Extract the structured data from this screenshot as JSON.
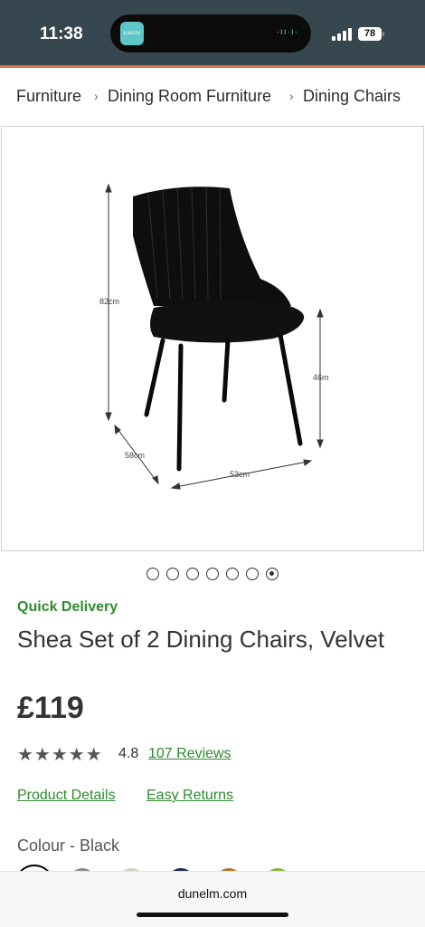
{
  "status_bar": {
    "time": "11:38",
    "battery": "78",
    "island_app_label": "KARON FAT"
  },
  "breadcrumb": {
    "items": [
      "Furniture",
      "Dining Room Furniture",
      "Dining Chairs"
    ],
    "separator": "›"
  },
  "gallery": {
    "dimensions": {
      "height": "82cm",
      "seat_height": "46m",
      "depth": "58cm",
      "width": "53cm"
    },
    "image_count": 7,
    "active_index": 6
  },
  "product": {
    "delivery_badge": "Quick Delivery",
    "title": "Shea Set of 2 Dining Chairs, Velvet",
    "price": "£119",
    "stars_text": "★★★★★",
    "rating": "4.8",
    "reviews_link": "107 Reviews",
    "details_link": "Product Details",
    "returns_link": "Easy Returns",
    "colour_label": "Colour - Black"
  },
  "swatches": [
    {
      "name": "Black",
      "color": "#111111"
    },
    {
      "name": "Grey",
      "color": "#8c8c8c"
    },
    {
      "name": "Natural",
      "color": "#d9cfc2"
    },
    {
      "name": "Navy",
      "color": "#1f2a5a"
    },
    {
      "name": "Ochre",
      "color": "#b8752f"
    },
    {
      "name": "Green",
      "color": "#8fb23a"
    }
  ],
  "browser": {
    "url": "dunelm.com"
  },
  "colors": {
    "accent": "#d9714b",
    "link_green": "#2e8b2e",
    "status_bar": "#37474f"
  }
}
